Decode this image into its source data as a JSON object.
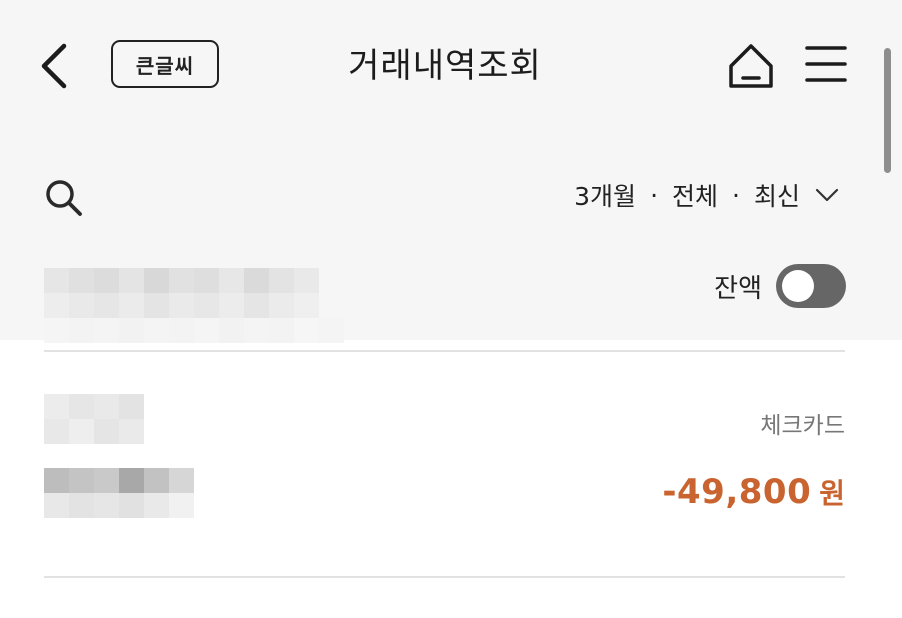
{
  "header": {
    "title": "거래내역조회",
    "big_font_label": "큰글씨",
    "back_icon": "chevron-left-icon",
    "home_icon": "home-icon",
    "menu_icon": "hamburger-menu-icon"
  },
  "filter": {
    "search_icon": "search-icon",
    "period": "3개월",
    "separator": "·",
    "type": "전체",
    "sort": "최신",
    "dropdown_icon": "chevron-down-icon"
  },
  "account": {
    "balance_label": "잔액",
    "balance_toggle_on": false
  },
  "transactions": [
    {
      "type": "체크카드",
      "amount": "-49,800",
      "currency": "원"
    }
  ],
  "colors": {
    "background": "#ffffff",
    "top_zone": "#f6f6f7",
    "amount_negative": "#c9632f",
    "toggle_off": "#666666",
    "muted_text": "#777777"
  }
}
